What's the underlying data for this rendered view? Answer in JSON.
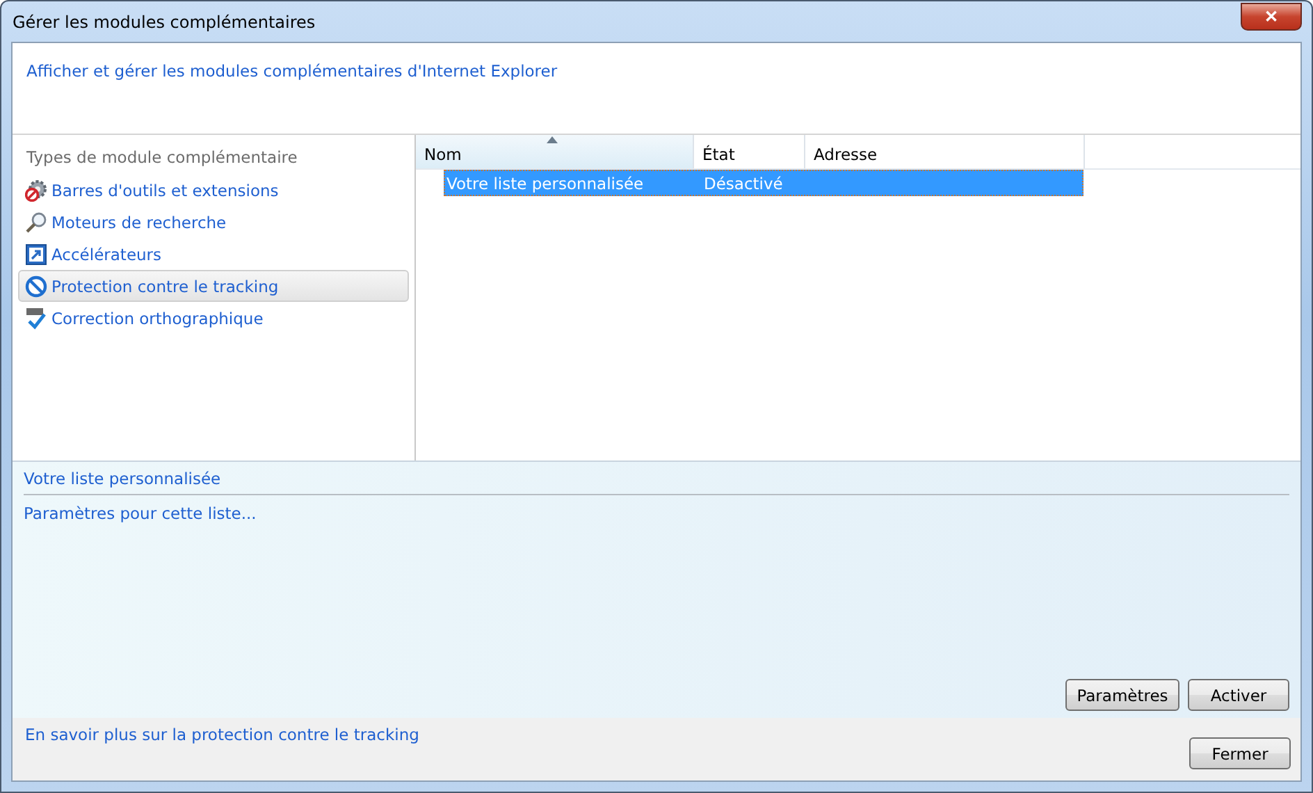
{
  "window": {
    "title": "Gérer les modules complémentaires",
    "close_label": "✕"
  },
  "header": {
    "text": "Afficher et gérer les modules complémentaires d'Internet Explorer"
  },
  "sidebar": {
    "heading": "Types de module complémentaire",
    "items": [
      {
        "label": "Barres d'outils et extensions",
        "kind": "toolbars",
        "selected": false
      },
      {
        "label": "Moteurs de recherche",
        "kind": "search",
        "selected": false
      },
      {
        "label": "Accélérateurs",
        "kind": "accelerators",
        "selected": false
      },
      {
        "label": "Protection contre le tracking",
        "kind": "tracking",
        "selected": true
      },
      {
        "label": "Correction orthographique",
        "kind": "spelling",
        "selected": false
      }
    ]
  },
  "table": {
    "columns": [
      {
        "label": "Nom",
        "sorted": true
      },
      {
        "label": "État",
        "sorted": false
      },
      {
        "label": "Adresse",
        "sorted": false
      }
    ],
    "rows": [
      {
        "cells": [
          "Votre liste personnalisée",
          "Désactivé",
          ""
        ],
        "selected": true
      }
    ]
  },
  "details": {
    "title": "Votre liste personnalisée",
    "link": "Paramètres pour cette liste...",
    "buttons": [
      "Paramètres",
      "Activer"
    ]
  },
  "footer": {
    "link": "En savoir plus sur la protection contre le tracking",
    "button": "Fermer"
  }
}
